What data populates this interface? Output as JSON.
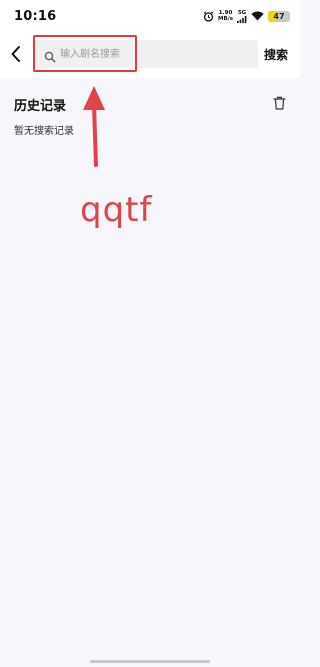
{
  "status_bar": {
    "time": "10:16",
    "net_speed_value": "1.90",
    "net_speed_unit": "MB/s",
    "signal_label": "5G",
    "battery_level": "47",
    "battery_fraction": 0.47,
    "battery_color": "#f2d21a",
    "icons": [
      "alarm-icon",
      "signal-icon",
      "wifi-icon",
      "battery-icon"
    ]
  },
  "header": {
    "back_icon": "chevron-left-icon",
    "search_placeholder": "输入剧名搜索",
    "search_icon": "search-icon",
    "search_button_label": "搜索"
  },
  "history": {
    "title": "历史记录",
    "clear_icon": "trash-icon",
    "empty_text": "暂无搜索记录"
  },
  "annotation": {
    "text": "qqtf",
    "color": "#e53a3f"
  }
}
